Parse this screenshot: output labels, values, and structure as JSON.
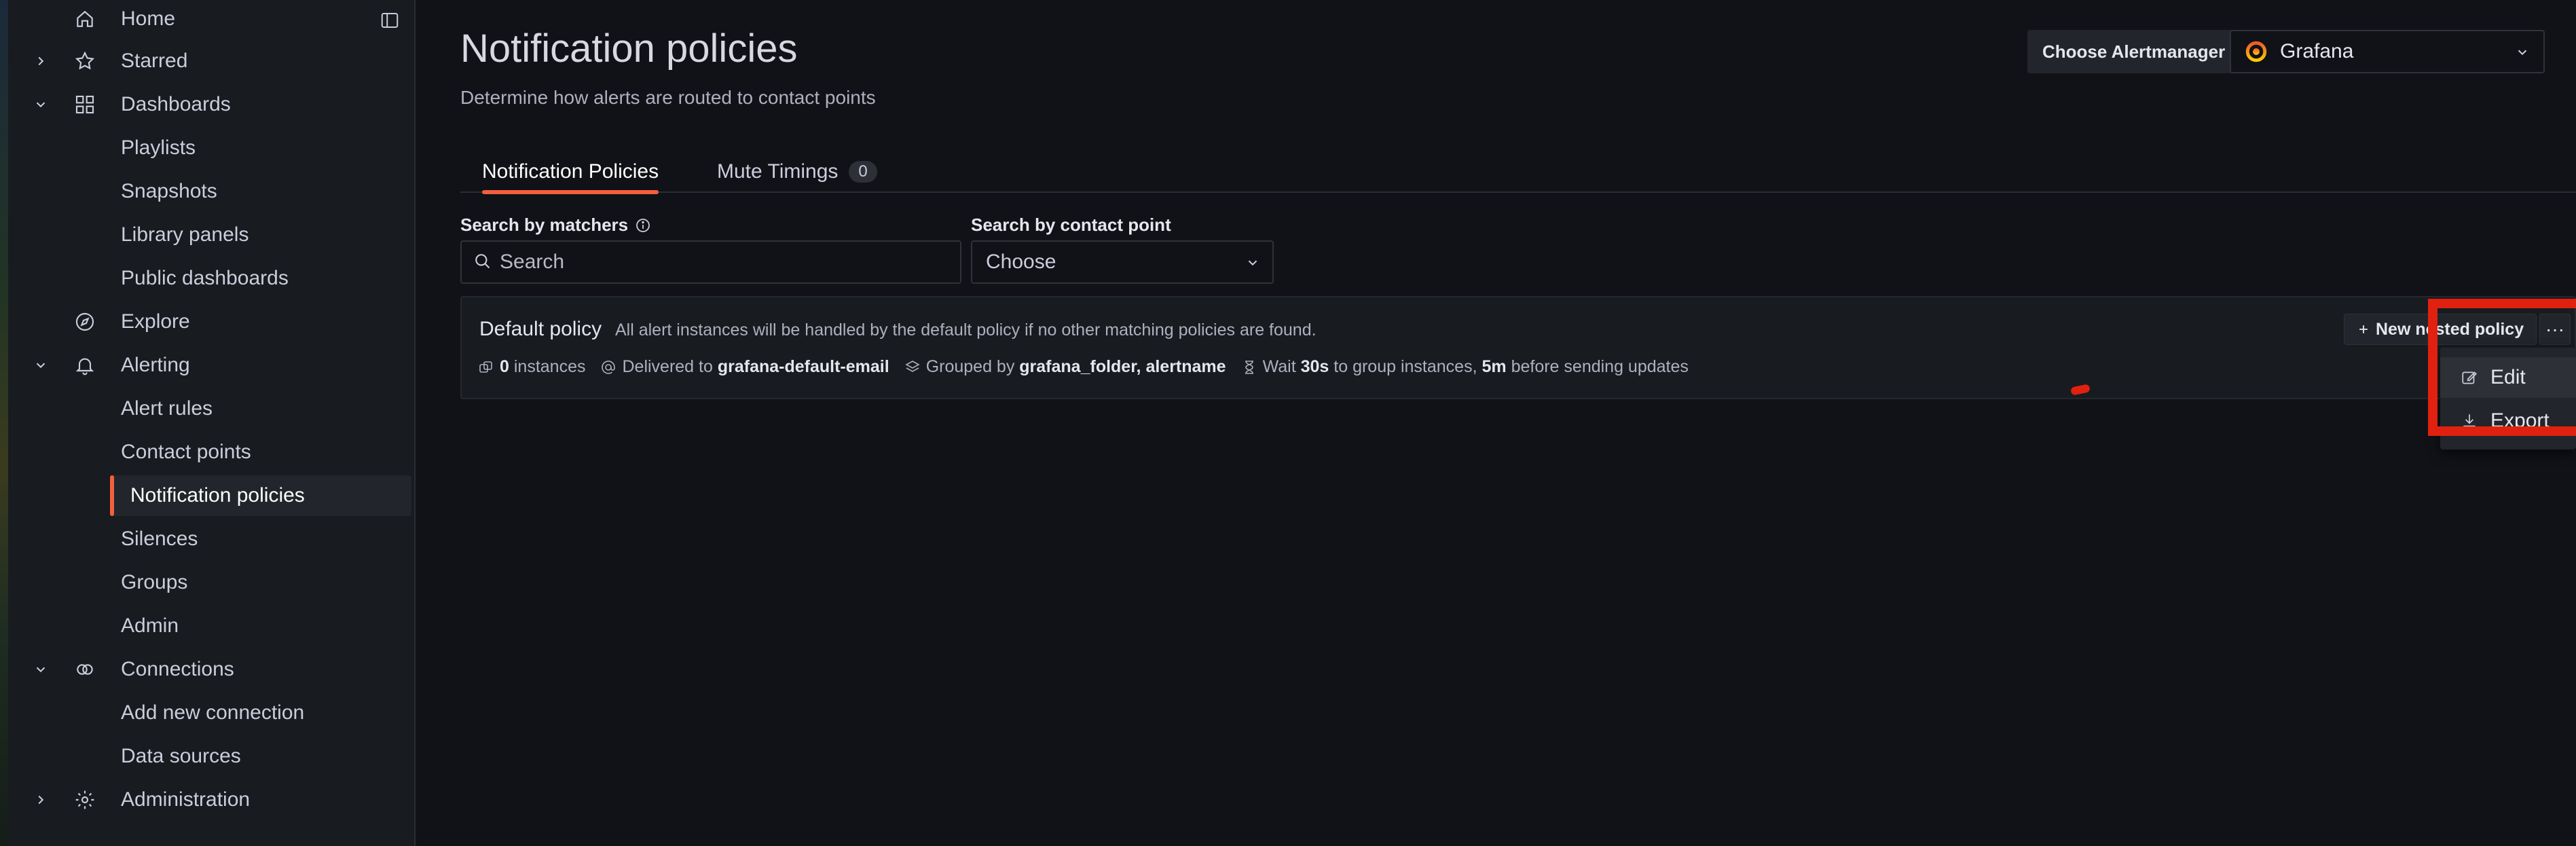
{
  "sidebar": {
    "items": [
      {
        "label": "Home",
        "icon": "home-icon",
        "chevron": ""
      },
      {
        "label": "Starred",
        "icon": "star-icon",
        "chevron": "right"
      },
      {
        "label": "Dashboards",
        "icon": "apps-icon",
        "chevron": "down"
      },
      {
        "label": "Playlists"
      },
      {
        "label": "Snapshots"
      },
      {
        "label": "Library panels"
      },
      {
        "label": "Public dashboards"
      },
      {
        "label": "Explore",
        "icon": "compass-icon",
        "chevron": ""
      },
      {
        "label": "Alerting",
        "icon": "bell-icon",
        "chevron": "down"
      },
      {
        "label": "Alert rules"
      },
      {
        "label": "Contact points"
      },
      {
        "label": "Notification policies",
        "active": true
      },
      {
        "label": "Silences"
      },
      {
        "label": "Groups"
      },
      {
        "label": "Admin"
      },
      {
        "label": "Connections",
        "icon": "link-icon",
        "chevron": "down"
      },
      {
        "label": "Add new connection"
      },
      {
        "label": "Data sources"
      },
      {
        "label": "Administration",
        "icon": "cog-icon",
        "chevron": "right"
      }
    ]
  },
  "page": {
    "title": "Notification policies",
    "subtitle": "Determine how alerts are routed to contact points"
  },
  "alertmanager": {
    "label": "Choose Alertmanager",
    "value": "Grafana"
  },
  "tabs": [
    {
      "label": "Notification Policies",
      "active": true
    },
    {
      "label": "Mute Timings",
      "count": "0"
    }
  ],
  "filters": {
    "matchers_label": "Search by matchers",
    "search_placeholder": "Search",
    "contact_label": "Search by contact point",
    "contact_value": "Choose"
  },
  "policy": {
    "title": "Default policy",
    "description": "All alert instances will be handled by the default policy if no other matching policies are found.",
    "instances_count": "0",
    "instances_label": "instances",
    "delivered_label": "Delivered to",
    "contact_point": "grafana-default-email",
    "grouped_label": "Grouped by",
    "grouped_by": "grafana_folder, alertname",
    "wait_label": "Wait",
    "wait_value": "30s",
    "wait_mid": "to group instances,",
    "repeat_value": "5m",
    "repeat_label": "before sending updates",
    "new_nested_label": "New nested policy",
    "more_label": "···"
  },
  "menu": {
    "items": [
      {
        "label": "Edit",
        "icon": "edit-icon"
      },
      {
        "label": "Export",
        "icon": "download-icon"
      }
    ]
  },
  "colors": {
    "accent": "#f55f3e",
    "annotation_red": "#e0210f",
    "background": "#111217",
    "sidebar": "#181b1f"
  }
}
